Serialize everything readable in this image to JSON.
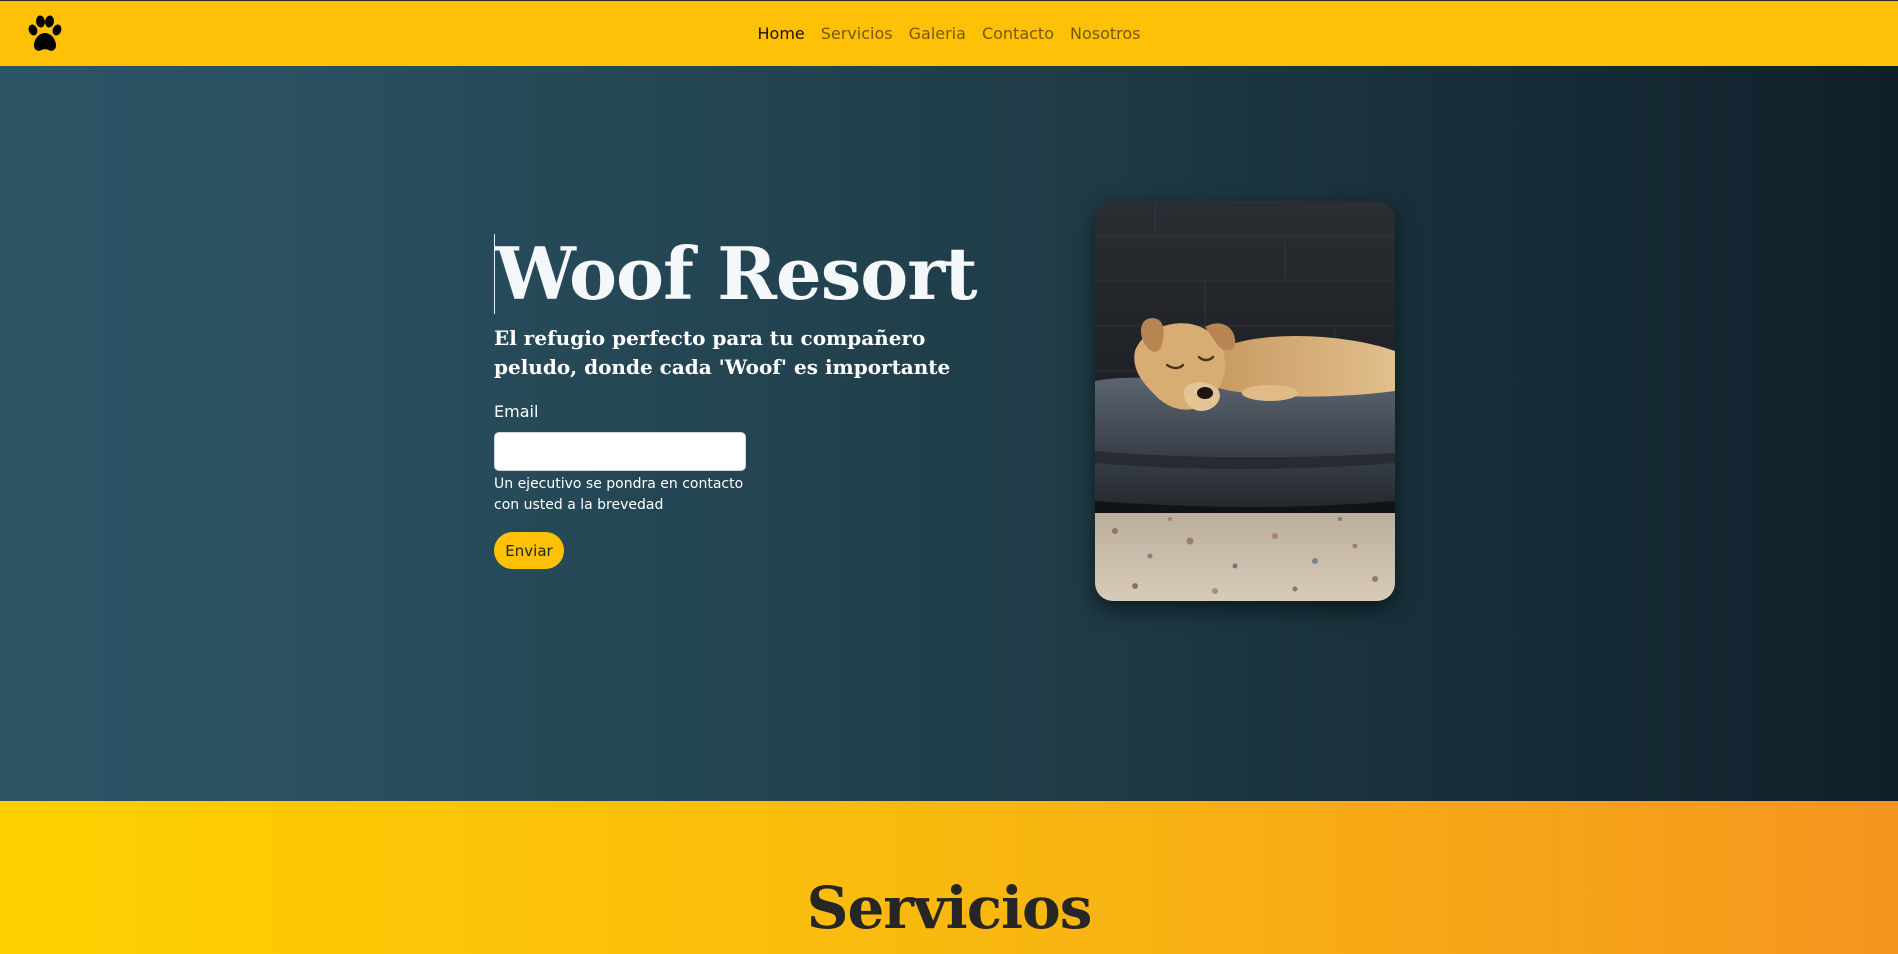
{
  "navbar": {
    "logo_icon": "paw-icon",
    "links": [
      {
        "label": "Home",
        "active": true
      },
      {
        "label": "Servicios",
        "active": false
      },
      {
        "label": "Galeria",
        "active": false
      },
      {
        "label": "Contacto",
        "active": false
      },
      {
        "label": "Nosotros",
        "active": false
      }
    ]
  },
  "hero": {
    "title": "Woof Resort",
    "subtitle": "El refugio perfecto para tu compañero peludo, donde cada 'Woof' es importante",
    "form": {
      "email_label": "Email",
      "email_value": "",
      "email_placeholder": "",
      "help_text": "Un ejecutivo se pondra en contacto con usted a la brevedad",
      "submit_label": "Enviar"
    },
    "image_subject": "dog-sleeping-on-bed"
  },
  "services": {
    "title": "Servicios"
  },
  "colors": {
    "navbar_bg": "#ffc107",
    "hero_gradient_start": "#2b5465",
    "hero_gradient_end": "#10202a",
    "button_bg": "#ffc107",
    "services_gradient_start": "#ffd000",
    "services_gradient_end": "#f5961f"
  }
}
